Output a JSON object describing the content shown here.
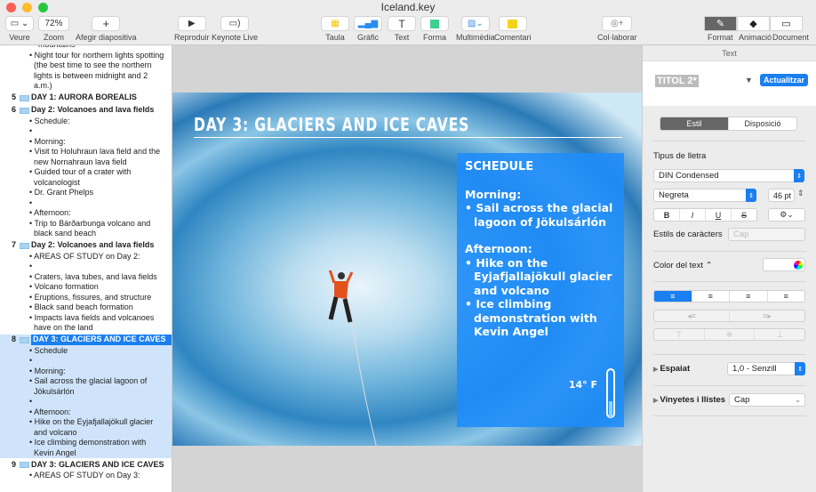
{
  "window": {
    "title": "Iceland.key"
  },
  "toolbar": {
    "view": {
      "label": "Veure",
      "icon": "view-icon"
    },
    "zoom": {
      "label": "Zoom",
      "value": "72%"
    },
    "add_slide": {
      "label": "Afegir diapositiva",
      "icon": "plus-icon"
    },
    "play": {
      "label": "Reproduir",
      "icon": "play-icon"
    },
    "keynote_live": {
      "label": "Keynote Live",
      "icon": "keynote-live-icon"
    },
    "table": {
      "label": "Taula",
      "icon": "table-icon"
    },
    "chart": {
      "label": "Gràfic",
      "icon": "chart-icon"
    },
    "text": {
      "label": "Text",
      "icon": "text-icon"
    },
    "shape": {
      "label": "Forma",
      "icon": "shape-icon"
    },
    "media": {
      "label": "Multimèdia",
      "icon": "media-icon"
    },
    "comment": {
      "label": "Comentari",
      "icon": "comment-icon"
    },
    "collaborate": {
      "label": "Col·laborar",
      "icon": "collaborate-icon"
    },
    "format": {
      "label": "Format"
    },
    "animate": {
      "label": "Animació"
    },
    "document": {
      "label": "Document"
    }
  },
  "outline": {
    "top_bullets": [
      {
        "cont": "mountains"
      },
      {
        "text": "Night tour for northern lights spotting (the best time to see the northern lights is between midnight and 2 a.m.)"
      }
    ],
    "slides": [
      {
        "num": "5",
        "title": "DAY 1: AURORA BOREALIS",
        "bullets": []
      },
      {
        "num": "6",
        "title": "Day 2: Volcanoes and lava fields",
        "bullets": [
          "Schedule:",
          "",
          "Morning:",
          "Visit to Holuhraun lava field and the new Nornahraun lava field",
          "Guided tour of a crater with volcanologist",
          "Dr. Grant Phelps",
          "",
          "Afternoon:",
          "Trip to Bárðarbunga volcano and black sand beach"
        ]
      },
      {
        "num": "7",
        "title": "Day 2: Volcanoes and lava fields",
        "bullets": [
          "AREAS OF STUDY on Day 2:",
          "",
          "Craters, lava tubes, and lava fields",
          "Volcano formation",
          "Eruptions, fissures, and structure",
          "Black sand beach formation",
          "Impacts lava fields and volcanoes have on the land"
        ]
      },
      {
        "num": "8",
        "title": "DAY 3: GLACIERS AND ICE CAVES",
        "selected": true,
        "bullets": [
          "Schedule",
          "",
          "Morning:",
          "Sail across the glacial lagoon of Jökulsárlón",
          "",
          "Afternoon:",
          "Hike on the Eyjafjallajökull glacier and volcano",
          "Ice climbing demonstration with Kevin Angel"
        ]
      },
      {
        "num": "9",
        "title": "DAY 3: GLACIERS AND ICE CAVES",
        "bullets": [
          "AREAS OF STUDY on Day 3:"
        ]
      }
    ]
  },
  "slide": {
    "title": "DAY 3: GLACIERS AND ICE CAVES",
    "box_heading": "SCHEDULE",
    "morning": "Morning:",
    "morning_items": [
      "Sail across the glacial lagoon of Jökulsárlón"
    ],
    "afternoon": "Afternoon:",
    "afternoon_items": [
      "Hike on the Eyjafjallajökull glacier and volcano",
      "Ice climbing demonstration with Kevin Angel"
    ],
    "temperature": "14° F",
    "box_color": "#1e8cfa"
  },
  "inspector": {
    "header": "Text",
    "paragraph_style": "TITOL 2*",
    "update_button": "Actualitzar",
    "tabs": [
      "Estil",
      "Disposició"
    ],
    "font_label": "Tipus de lletra",
    "font": "DIN Condensed",
    "weight": "Negreta",
    "size": "46 pt",
    "bius": [
      "B",
      "I",
      "U",
      "S"
    ],
    "char_styles_label": "Estils de caràcters",
    "char_style": "Cap",
    "text_color_label": "Color del text ⌃",
    "spacing_label": "Espaiat",
    "spacing": "1,0 - Senzill",
    "bullets_label": "Vinyetes i llistes",
    "bullets": "Cap",
    "accent": "#1a7ff0"
  }
}
